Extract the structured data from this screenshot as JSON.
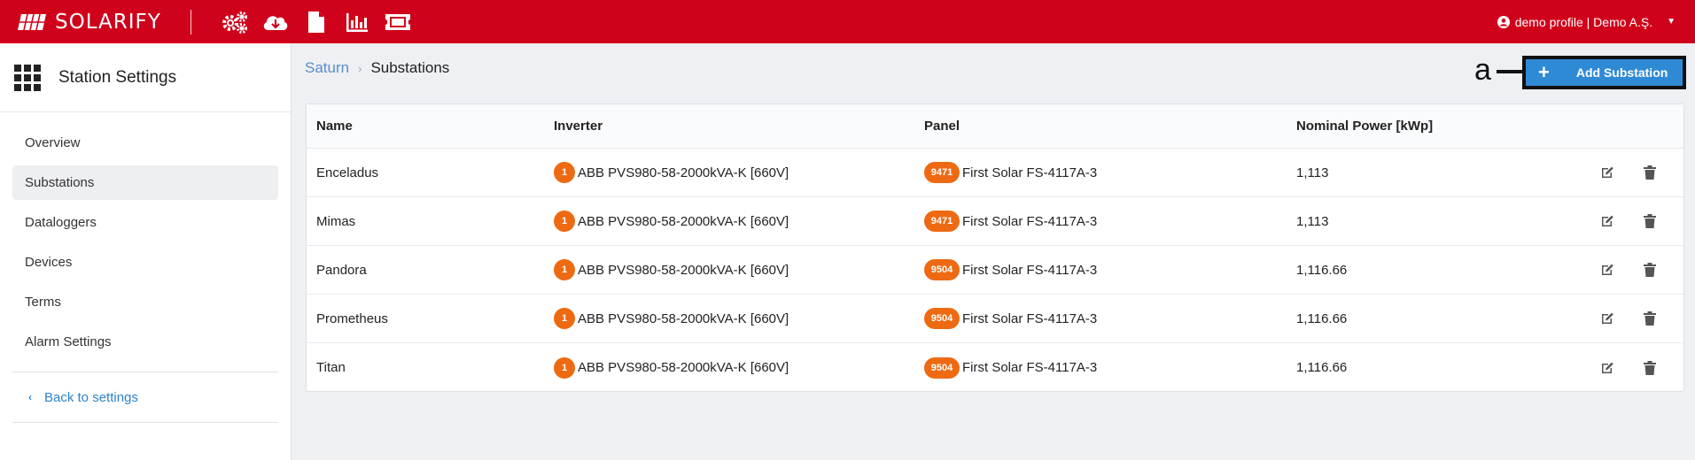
{
  "header": {
    "brand": "SOLARIFY",
    "nav_icons": [
      "settings-icon",
      "cloud-download-icon",
      "document-icon",
      "bar-chart-icon",
      "ticket-icon"
    ],
    "profile": "demo profile | Demo A.Ş."
  },
  "sidebar": {
    "title": "Station Settings",
    "items": [
      {
        "label": "Overview"
      },
      {
        "label": "Substations",
        "active": true
      },
      {
        "label": "Dataloggers"
      },
      {
        "label": "Devices"
      },
      {
        "label": "Terms"
      },
      {
        "label": "Alarm Settings"
      }
    ],
    "back": "Back to settings"
  },
  "breadcrumb": {
    "parent": "Saturn",
    "current": "Substations"
  },
  "annotation": "a",
  "add_button": {
    "label": "Add Substation"
  },
  "table": {
    "headers": {
      "name": "Name",
      "inverter": "Inverter",
      "panel": "Panel",
      "power": "Nominal Power [kWp]"
    },
    "rows": [
      {
        "name": "Enceladus",
        "inv_count": "1",
        "inverter": "ABB PVS980-58-2000kVA-K [660V]",
        "panel_count": "9471",
        "panel": "First Solar FS-4117A-3",
        "power": "1,113"
      },
      {
        "name": "Mimas",
        "inv_count": "1",
        "inverter": "ABB PVS980-58-2000kVA-K [660V]",
        "panel_count": "9471",
        "panel": "First Solar FS-4117A-3",
        "power": "1,113"
      },
      {
        "name": "Pandora",
        "inv_count": "1",
        "inverter": "ABB PVS980-58-2000kVA-K [660V]",
        "panel_count": "9504",
        "panel": "First Solar FS-4117A-3",
        "power": "1,116.66"
      },
      {
        "name": "Prometheus",
        "inv_count": "1",
        "inverter": "ABB PVS980-58-2000kVA-K [660V]",
        "panel_count": "9504",
        "panel": "First Solar FS-4117A-3",
        "power": "1,116.66"
      },
      {
        "name": "Titan",
        "inv_count": "1",
        "inverter": "ABB PVS980-58-2000kVA-K [660V]",
        "panel_count": "9504",
        "panel": "First Solar FS-4117A-3",
        "power": "1,116.66"
      }
    ]
  },
  "colors": {
    "brand_red": "#d0021b",
    "accent_blue": "#2f8ad6",
    "badge_orange": "#ee6a12",
    "link_blue": "#2e82c9"
  }
}
